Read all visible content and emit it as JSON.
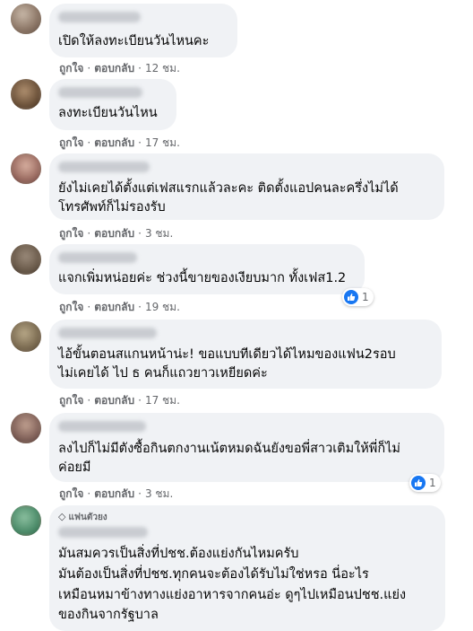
{
  "actions": {
    "like": "ถูกใจ",
    "reply": "ตอบกลับ",
    "separator": "·"
  },
  "badge": {
    "icon": "diamond-icon",
    "label": "แฟนตัวยง"
  },
  "colors": {
    "bubble": "#f0f2f5",
    "like_blue": "#1877f2",
    "meta_gray": "#65676b"
  },
  "comments": [
    {
      "lines": [
        "เปิดให้ลงทะเบียนวันไหนคะ"
      ],
      "time": "12 ชม."
    },
    {
      "lines": [
        "ลงทะเบียนวันไหน"
      ],
      "time": "17 ชม."
    },
    {
      "lines": [
        "ยังไม่เคยได้ตั้งแต่เฟสแรกแล้วละคะ ติดตั้งแอปคนละครึ่งไม่ได้",
        "โทรศัพท์ก็ไม่รองรับ"
      ],
      "time": "3 ชม."
    },
    {
      "lines": [
        "แจกเพิ่มหน่อยค่ะ ช่วงนี้ขายของเงียบมาก ทั้งเฟส1.2"
      ],
      "time": "19 ชม.",
      "reactions": "1"
    },
    {
      "lines": [
        "ไอ้ขั้นตอนสแกนหน้าน่ะ! ขอแบบทีเดียวได้ไหมของแฟน2รอบ",
        "ไม่เคยได้ ไป ธ คนก็แถวยาวเหยียดค่ะ"
      ],
      "time": "17 ชม."
    },
    {
      "lines": [
        "ลงไปก็ไม่มีตังซื้อกินตกงานเน้ตหมดฉันยังขอพี่สาวเติมให้พี่ก็ไม่",
        "ค่อยมี"
      ],
      "time": "3 ชม.",
      "reactions": "1"
    },
    {
      "lines": [
        "มันสมควรเป็นสิ่งที่ปชช.ต้องแย่งกันไหมครับ",
        "มันต้องเป็นสิ่งที่ปชช.ทุกคนจะต้องได้รับไม่ใช่หรอ นี่อะไร",
        "เหมือนหมาข้างทางแย่งอาหารจากคนอ่ะ ดูๆไปเหมือนปชช.แย่ง",
        "ของกินจากรัฐบาล"
      ]
    }
  ]
}
